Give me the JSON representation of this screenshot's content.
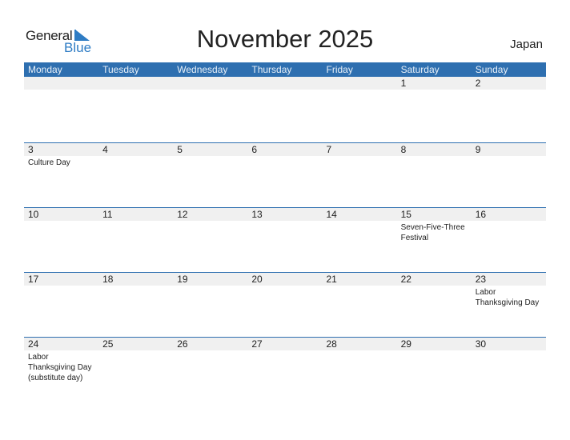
{
  "logo": {
    "word1": "General",
    "word2": "Blue"
  },
  "header": {
    "title": "November 2025",
    "country": "Japan"
  },
  "colors": {
    "accent": "#2e6fb0",
    "day_bar": "#f0f0f0",
    "logo_blue": "#2e7cc4"
  },
  "weekdays": [
    "Monday",
    "Tuesday",
    "Wednesday",
    "Thursday",
    "Friday",
    "Saturday",
    "Sunday"
  ],
  "weeks": [
    [
      {
        "day": "",
        "event": ""
      },
      {
        "day": "",
        "event": ""
      },
      {
        "day": "",
        "event": ""
      },
      {
        "day": "",
        "event": ""
      },
      {
        "day": "",
        "event": ""
      },
      {
        "day": "1",
        "event": ""
      },
      {
        "day": "2",
        "event": ""
      }
    ],
    [
      {
        "day": "3",
        "event": "Culture Day"
      },
      {
        "day": "4",
        "event": ""
      },
      {
        "day": "5",
        "event": ""
      },
      {
        "day": "6",
        "event": ""
      },
      {
        "day": "7",
        "event": ""
      },
      {
        "day": "8",
        "event": ""
      },
      {
        "day": "9",
        "event": ""
      }
    ],
    [
      {
        "day": "10",
        "event": ""
      },
      {
        "day": "11",
        "event": ""
      },
      {
        "day": "12",
        "event": ""
      },
      {
        "day": "13",
        "event": ""
      },
      {
        "day": "14",
        "event": ""
      },
      {
        "day": "15",
        "event": "Seven-Five-Three\nFestival"
      },
      {
        "day": "16",
        "event": ""
      }
    ],
    [
      {
        "day": "17",
        "event": ""
      },
      {
        "day": "18",
        "event": ""
      },
      {
        "day": "19",
        "event": ""
      },
      {
        "day": "20",
        "event": ""
      },
      {
        "day": "21",
        "event": ""
      },
      {
        "day": "22",
        "event": ""
      },
      {
        "day": "23",
        "event": "Labor\nThanksgiving Day"
      }
    ],
    [
      {
        "day": "24",
        "event": "Labor\nThanksgiving Day\n(substitute day)"
      },
      {
        "day": "25",
        "event": ""
      },
      {
        "day": "26",
        "event": ""
      },
      {
        "day": "27",
        "event": ""
      },
      {
        "day": "28",
        "event": ""
      },
      {
        "day": "29",
        "event": ""
      },
      {
        "day": "30",
        "event": ""
      }
    ]
  ]
}
